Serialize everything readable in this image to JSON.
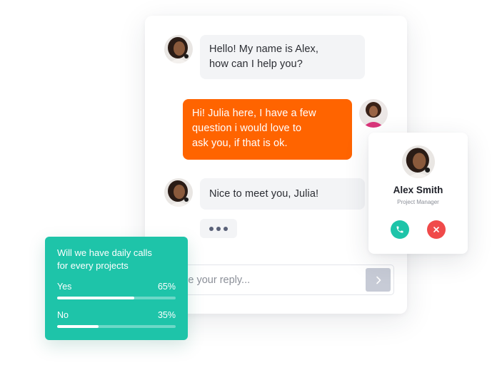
{
  "chat": {
    "messages": [
      {
        "from": "agent",
        "text_line1": "Hello! My name is Alex,",
        "text_line2": "how can I help you?"
      },
      {
        "from": "user",
        "text_line1": "Hi! Julia here, I have a few",
        "text_line2": "question i would love to",
        "text_line3": "ask you, if that is ok."
      },
      {
        "from": "agent",
        "text": "Nice to meet you, Julia!"
      }
    ],
    "reply": {
      "placeholder": "Type your reply...",
      "value": ""
    },
    "send_icon": "chevron-right-icon"
  },
  "poll": {
    "title_line1": "Will we have daily calls",
    "title_line2": "for every projects",
    "options": [
      {
        "label": "Yes",
        "percent_label": "65%",
        "percent": 65
      },
      {
        "label": "No",
        "percent_label": "35%",
        "percent": 35
      }
    ]
  },
  "contact": {
    "name": "Alex Smith",
    "role": "Project Manager",
    "accept_icon": "phone-icon",
    "decline_icon": "close-icon"
  },
  "colors": {
    "accent_orange": "#ff6400",
    "accent_teal": "#1ec4a9",
    "decline_red": "#f04a4a",
    "bubble_grey": "#f3f4f6"
  }
}
